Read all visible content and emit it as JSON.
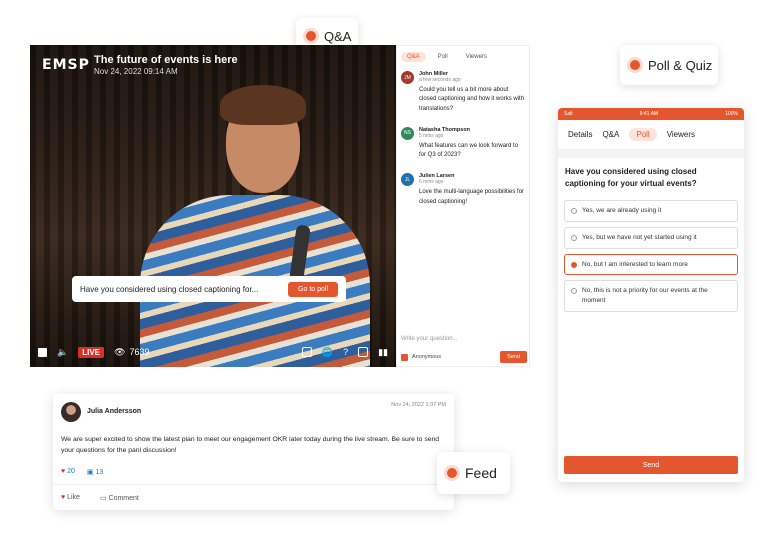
{
  "labels": {
    "qa": "Q&A",
    "poll_quiz": "Poll & Quiz",
    "feed": "Feed"
  },
  "video": {
    "logo": "EMSP",
    "title": "The future of events is here",
    "date": "Nov 24, 2022 09:14 AM",
    "poll_toast_text": "Have you considered using closed captioning for...",
    "go_to_poll": "Go to poll",
    "live": "LIVE",
    "viewer_count": "7639"
  },
  "chat": {
    "tabs": [
      "Q&A",
      "Poll",
      "Viewers"
    ],
    "messages": [
      {
        "initials": "JM",
        "name": "John Miller",
        "time": "a few seconds ago",
        "text": "Could you tell us a bit more about closed captioning and how it works with translations?",
        "color": "#a33a2b"
      },
      {
        "initials": "NS",
        "name": "Natasha Thompson",
        "time": "5 mins ago",
        "text": "What features can we look forward to for Q3 of 2023?",
        "color": "#2e8b57"
      },
      {
        "initials": "JL",
        "name": "Julien Larsen",
        "time": "6 mins ago",
        "text": "Love the multi-language possibilities for closed captioning!",
        "color": "#1f6fa8"
      }
    ],
    "input_placeholder": "Write your question...",
    "anonymous": "Anonymous",
    "send": "Send"
  },
  "phone": {
    "status_left": "Salt",
    "status_time": "9:41 AM",
    "status_right": "100%",
    "tabs": [
      "Details",
      "Q&A",
      "Poll",
      "Viewers"
    ],
    "question": "Have you considered using closed captioning for your virtual events?",
    "options": [
      "Yes, we are already using it",
      "Yes, but we have not yet started using it",
      "No, but I am interested to learn more",
      "No, this is not a priority for our events at the moment"
    ],
    "selected_index": 2,
    "send": "Send"
  },
  "feed": {
    "name": "Julia Andersson",
    "date": "Nov 24, 2022 1:37 PM",
    "text": "We are super excited to show the latest plan to meet our engagement OKR later today during the live stream. Be sure to send your questions for the panl discussion!",
    "likes": "20",
    "comments": "13",
    "like_label": "Like",
    "comment_label": "Comment"
  }
}
